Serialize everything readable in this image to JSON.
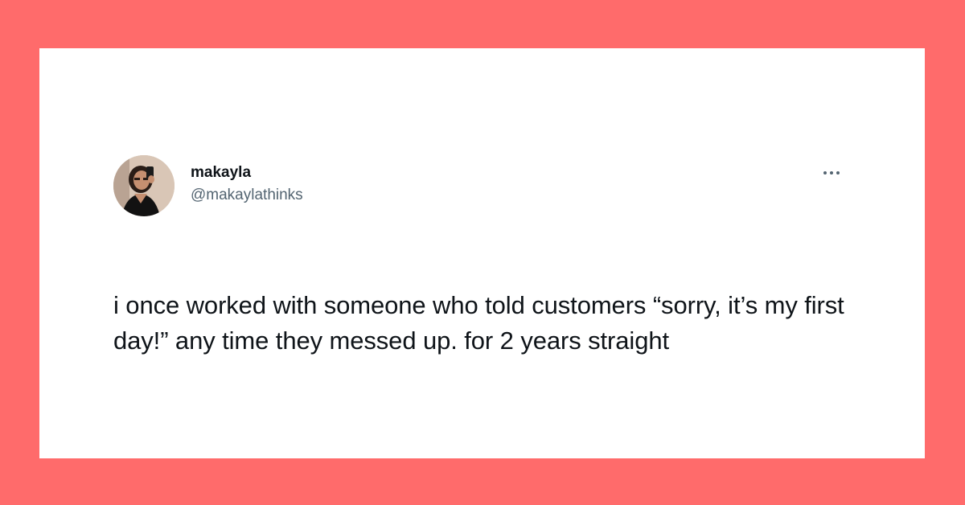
{
  "tweet": {
    "author": {
      "display_name": "makayla",
      "handle": "@makaylathinks",
      "avatar_icon": "profile-photo"
    },
    "more_icon": "more-options-icon",
    "text": "i once worked with someone who told customers “sorry, it’s my first day!” any time they messed up. for 2 years straight"
  },
  "colors": {
    "background": "#ff6b6b",
    "card": "#ffffff",
    "text_primary": "#0f1419",
    "text_secondary": "#536471"
  }
}
